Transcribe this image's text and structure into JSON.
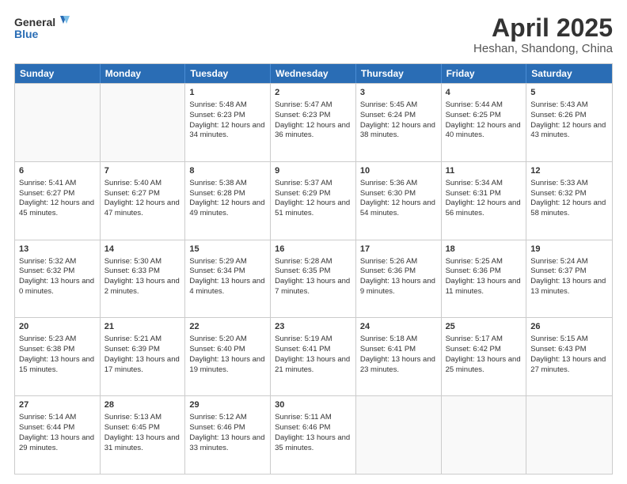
{
  "header": {
    "logo_line1": "General",
    "logo_line2": "Blue",
    "main_title": "April 2025",
    "subtitle": "Heshan, Shandong, China"
  },
  "calendar": {
    "days_of_week": [
      "Sunday",
      "Monday",
      "Tuesday",
      "Wednesday",
      "Thursday",
      "Friday",
      "Saturday"
    ],
    "rows": [
      [
        {
          "day": "",
          "empty": true
        },
        {
          "day": "",
          "empty": true
        },
        {
          "day": "1",
          "sunrise": "5:48 AM",
          "sunset": "6:23 PM",
          "daylight": "12 hours and 34 minutes."
        },
        {
          "day": "2",
          "sunrise": "5:47 AM",
          "sunset": "6:23 PM",
          "daylight": "12 hours and 36 minutes."
        },
        {
          "day": "3",
          "sunrise": "5:45 AM",
          "sunset": "6:24 PM",
          "daylight": "12 hours and 38 minutes."
        },
        {
          "day": "4",
          "sunrise": "5:44 AM",
          "sunset": "6:25 PM",
          "daylight": "12 hours and 40 minutes."
        },
        {
          "day": "5",
          "sunrise": "5:43 AM",
          "sunset": "6:26 PM",
          "daylight": "12 hours and 43 minutes."
        }
      ],
      [
        {
          "day": "6",
          "sunrise": "5:41 AM",
          "sunset": "6:27 PM",
          "daylight": "12 hours and 45 minutes."
        },
        {
          "day": "7",
          "sunrise": "5:40 AM",
          "sunset": "6:27 PM",
          "daylight": "12 hours and 47 minutes."
        },
        {
          "day": "8",
          "sunrise": "5:38 AM",
          "sunset": "6:28 PM",
          "daylight": "12 hours and 49 minutes."
        },
        {
          "day": "9",
          "sunrise": "5:37 AM",
          "sunset": "6:29 PM",
          "daylight": "12 hours and 51 minutes."
        },
        {
          "day": "10",
          "sunrise": "5:36 AM",
          "sunset": "6:30 PM",
          "daylight": "12 hours and 54 minutes."
        },
        {
          "day": "11",
          "sunrise": "5:34 AM",
          "sunset": "6:31 PM",
          "daylight": "12 hours and 56 minutes."
        },
        {
          "day": "12",
          "sunrise": "5:33 AM",
          "sunset": "6:32 PM",
          "daylight": "12 hours and 58 minutes."
        }
      ],
      [
        {
          "day": "13",
          "sunrise": "5:32 AM",
          "sunset": "6:32 PM",
          "daylight": "13 hours and 0 minutes."
        },
        {
          "day": "14",
          "sunrise": "5:30 AM",
          "sunset": "6:33 PM",
          "daylight": "13 hours and 2 minutes."
        },
        {
          "day": "15",
          "sunrise": "5:29 AM",
          "sunset": "6:34 PM",
          "daylight": "13 hours and 4 minutes."
        },
        {
          "day": "16",
          "sunrise": "5:28 AM",
          "sunset": "6:35 PM",
          "daylight": "13 hours and 7 minutes."
        },
        {
          "day": "17",
          "sunrise": "5:26 AM",
          "sunset": "6:36 PM",
          "daylight": "13 hours and 9 minutes."
        },
        {
          "day": "18",
          "sunrise": "5:25 AM",
          "sunset": "6:36 PM",
          "daylight": "13 hours and 11 minutes."
        },
        {
          "day": "19",
          "sunrise": "5:24 AM",
          "sunset": "6:37 PM",
          "daylight": "13 hours and 13 minutes."
        }
      ],
      [
        {
          "day": "20",
          "sunrise": "5:23 AM",
          "sunset": "6:38 PM",
          "daylight": "13 hours and 15 minutes."
        },
        {
          "day": "21",
          "sunrise": "5:21 AM",
          "sunset": "6:39 PM",
          "daylight": "13 hours and 17 minutes."
        },
        {
          "day": "22",
          "sunrise": "5:20 AM",
          "sunset": "6:40 PM",
          "daylight": "13 hours and 19 minutes."
        },
        {
          "day": "23",
          "sunrise": "5:19 AM",
          "sunset": "6:41 PM",
          "daylight": "13 hours and 21 minutes."
        },
        {
          "day": "24",
          "sunrise": "5:18 AM",
          "sunset": "6:41 PM",
          "daylight": "13 hours and 23 minutes."
        },
        {
          "day": "25",
          "sunrise": "5:17 AM",
          "sunset": "6:42 PM",
          "daylight": "13 hours and 25 minutes."
        },
        {
          "day": "26",
          "sunrise": "5:15 AM",
          "sunset": "6:43 PM",
          "daylight": "13 hours and 27 minutes."
        }
      ],
      [
        {
          "day": "27",
          "sunrise": "5:14 AM",
          "sunset": "6:44 PM",
          "daylight": "13 hours and 29 minutes."
        },
        {
          "day": "28",
          "sunrise": "5:13 AM",
          "sunset": "6:45 PM",
          "daylight": "13 hours and 31 minutes."
        },
        {
          "day": "29",
          "sunrise": "5:12 AM",
          "sunset": "6:46 PM",
          "daylight": "13 hours and 33 minutes."
        },
        {
          "day": "30",
          "sunrise": "5:11 AM",
          "sunset": "6:46 PM",
          "daylight": "13 hours and 35 minutes."
        },
        {
          "day": "",
          "empty": true
        },
        {
          "day": "",
          "empty": true
        },
        {
          "day": "",
          "empty": true
        }
      ]
    ]
  }
}
